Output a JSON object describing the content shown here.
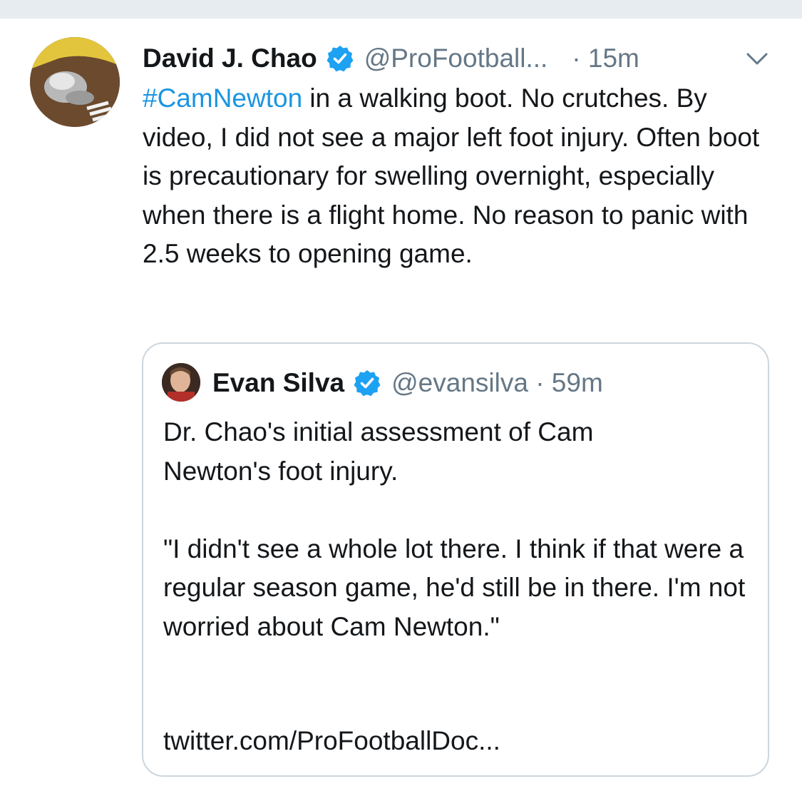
{
  "tweet": {
    "author_name": "David J. Chao",
    "handle": "@ProFootball...",
    "time": "· 15m",
    "hashtag": "#CamNewton",
    "text_rest": " in a walking boot. No crutches. By video, I did not see a major left foot injury. Often boot is precautionary for swelling overnight, especially when there is a flight home. No reason to panic with 2.5 weeks to opening game.",
    "hashtag_color": "#1b95e0",
    "verified_color": "#1da1f2",
    "menu_icon": "chevron-down-icon"
  },
  "quoted_tweet": {
    "author_name": "Evan Silva",
    "handle_time": "@evansilva · 59m",
    "paragraph_1": "Dr. Chao's initial assessment of Cam Newton's foot injury.",
    "paragraph_2": "\"I didn't see a whole lot there. I think if that were a regular season game, he'd still be in there. I'm not worried about Cam Newton.\"",
    "link": "twitter.com/ProFootballDoc..."
  }
}
